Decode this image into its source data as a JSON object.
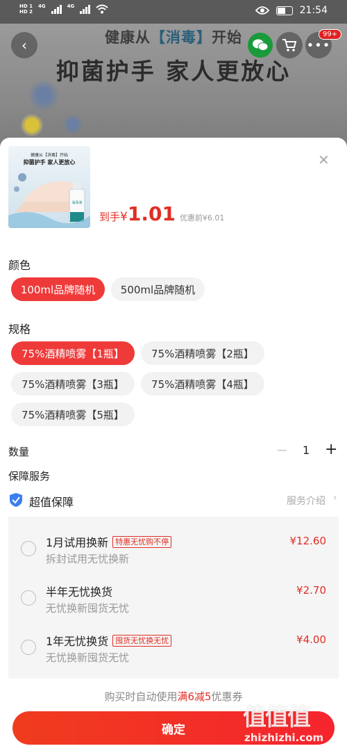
{
  "status_bar": {
    "hd1": "HD 1",
    "hd2": "HD 2",
    "net1": "4G",
    "net2": "4G",
    "time": "21:54"
  },
  "banner": {
    "line1_a": "健康从",
    "line1_b": "【消毒】",
    "line1_c": "开始",
    "line2": "抑菌护手  家人更放心",
    "cart_badge": "99+"
  },
  "product": {
    "thumb_line1": "健康从【消毒】开始",
    "thumb_line2": "抑菌护手  家人更放心",
    "thumb_bottle_label": "消毒液",
    "price_prefix": "到手",
    "currency": "¥",
    "price": "1.01",
    "original_price": "优惠前¥6.01"
  },
  "color": {
    "title": "颜色",
    "options": [
      "100ml品牌随机",
      "500ml品牌随机"
    ],
    "selected": 0
  },
  "spec": {
    "title": "规格",
    "options": [
      "75%酒精喷雾【1瓶】",
      "75%酒精喷雾【2瓶】",
      "75%酒精喷雾【3瓶】",
      "75%酒精喷雾【4瓶】",
      "75%酒精喷雾【5瓶】"
    ],
    "selected": 0
  },
  "quantity": {
    "label": "数量",
    "value": "1",
    "minus": "−",
    "plus": "+"
  },
  "service": {
    "title": "保障服务",
    "name": "超值保障",
    "intro": "服务介绍",
    "options": [
      {
        "title": "1月试用换新",
        "tag": "特惠无忧购不停",
        "sub": "拆封试用无忧换新",
        "price": "¥12.60"
      },
      {
        "title": "半年无忧换货",
        "tag": "",
        "sub": "无忧换新囤货无忧",
        "price": "¥2.70"
      },
      {
        "title": "1年无忧换货",
        "tag": "囤货无忧换无忧",
        "sub": "无忧换新囤货无忧",
        "price": "¥4.00"
      }
    ]
  },
  "coupon": {
    "prefix": "购买时自动使用",
    "highlight": "满6减5",
    "suffix": "优惠券"
  },
  "confirm_label": "确定",
  "watermark": {
    "logo": "值值值",
    "site": "zhizhizhi.com"
  },
  "colors": {
    "accent": "#ef3a3a",
    "price": "#e02e24"
  }
}
